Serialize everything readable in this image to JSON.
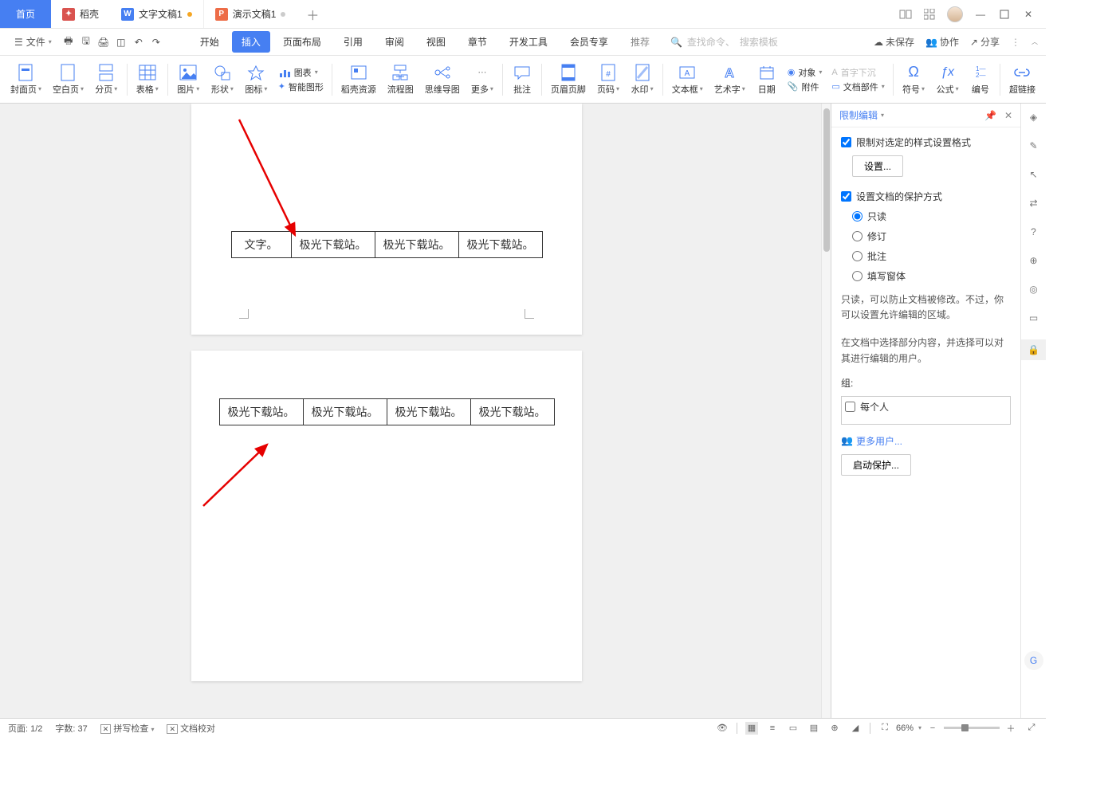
{
  "tabs": {
    "home": "首页",
    "dock": "稻壳",
    "doc1": "文字文稿1",
    "doc2": "演示文稿1"
  },
  "file_label": "文件",
  "menus": {
    "start": "开始",
    "insert": "插入",
    "layout": "页面布局",
    "ref": "引用",
    "review": "审阅",
    "view": "视图",
    "chapter": "章节",
    "dev": "开发工具",
    "vip": "会员专享",
    "rec": "推荐"
  },
  "search": {
    "cmd": "查找命令、",
    "tpl": "搜索模板"
  },
  "topright": {
    "unsaved": "未保存",
    "coop": "协作",
    "share": "分享"
  },
  "ribbon": {
    "cover": "封面页",
    "blank": "空白页",
    "pagebreak": "分页",
    "table": "表格",
    "pic": "图片",
    "shape": "形状",
    "icon": "图标",
    "chart": "图表",
    "smart": "智能图形",
    "dockres": "稻壳资源",
    "flow": "流程图",
    "mind": "思维导图",
    "more": "更多",
    "comment": "批注",
    "headerfooter": "页眉页脚",
    "pagenum": "页码",
    "watermark": "水印",
    "textbox": "文本框",
    "wordart": "艺术字",
    "date": "日期",
    "object": "对象",
    "attach": "附件",
    "cap": "首字下沉",
    "docpart": "文档部件",
    "symbol": "符号",
    "formula": "公式",
    "number": "编号",
    "hyperlink": "超链接"
  },
  "panel": {
    "title": "限制编辑",
    "chk1": "限制对选定的样式设置格式",
    "btn_set": "设置...",
    "chk2": "设置文档的保护方式",
    "r1": "只读",
    "r2": "修订",
    "r3": "批注",
    "r4": "填写窗体",
    "desc1": "只读，可以防止文档被修改。不过，你可以设置允许编辑的区域。",
    "desc2": "在文档中选择部分内容，并选择可以对其进行编辑的用户。",
    "group": "组:",
    "everyone": "每个人",
    "moreusers": "更多用户...",
    "start": "启动保护..."
  },
  "doc": {
    "r1c1": "文字。",
    "cell": "极光下载站。"
  },
  "status": {
    "page": "页面: 1/2",
    "words": "字数: 37",
    "spell": "拼写检查",
    "proof": "文档校对",
    "zoom": "66%"
  }
}
